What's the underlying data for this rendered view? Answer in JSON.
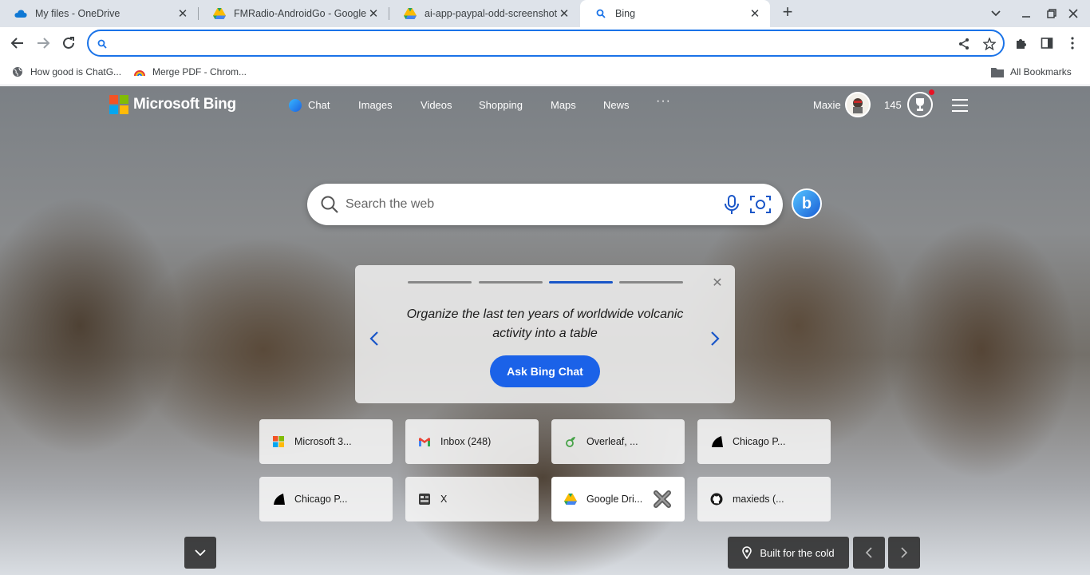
{
  "browser": {
    "tabs": [
      {
        "title": "My files - OneDrive",
        "icon": "onedrive-icon"
      },
      {
        "title": "FMRadio-AndroidGo - Google Dr",
        "icon": "google-drive-icon"
      },
      {
        "title": "ai-app-paypal-odd-screenshots",
        "icon": "google-drive-icon"
      },
      {
        "title": "Bing",
        "icon": "search-icon",
        "active": true
      }
    ],
    "address": {
      "value": "",
      "placeholder": ""
    },
    "bookmarks": [
      {
        "label": "How good is ChatG...",
        "icon": "globe-icon"
      },
      {
        "label": "Merge PDF - Chrom...",
        "icon": "merge-pdf-icon"
      }
    ],
    "all_bookmarks_label": "All Bookmarks"
  },
  "bing": {
    "brand": "Microsoft Bing",
    "nav": [
      "Chat",
      "Images",
      "Videos",
      "Shopping",
      "Maps",
      "News"
    ],
    "more": "···",
    "user": "Maxie",
    "points": "145",
    "search_placeholder": "Search the web",
    "copilot_letter": "b",
    "promo": {
      "text": "Organize the last ten years of worldwide volcanic activity into a table",
      "button": "Ask Bing Chat",
      "active_step": 3,
      "steps": 4
    },
    "tiles": [
      {
        "label": "Microsoft 3...",
        "icon": "microsoft-icon"
      },
      {
        "label": "Inbox (248)",
        "icon": "gmail-icon"
      },
      {
        "label": "Overleaf, ...",
        "icon": "overleaf-icon"
      },
      {
        "label": "Chicago P...",
        "icon": "chicago-icon"
      },
      {
        "label": "Chicago P...",
        "icon": "chicago-icon"
      },
      {
        "label": "X",
        "icon": "x-icon"
      },
      {
        "label": "Google Dri...",
        "icon": "google-drive-icon"
      },
      {
        "label": "maxieds (...",
        "icon": "github-icon"
      }
    ],
    "image_info": "Built for the cold"
  },
  "colors": {
    "accent": "#1a73e8",
    "bing_blue": "#1b62e8",
    "tabbar": "#dee3ea"
  }
}
